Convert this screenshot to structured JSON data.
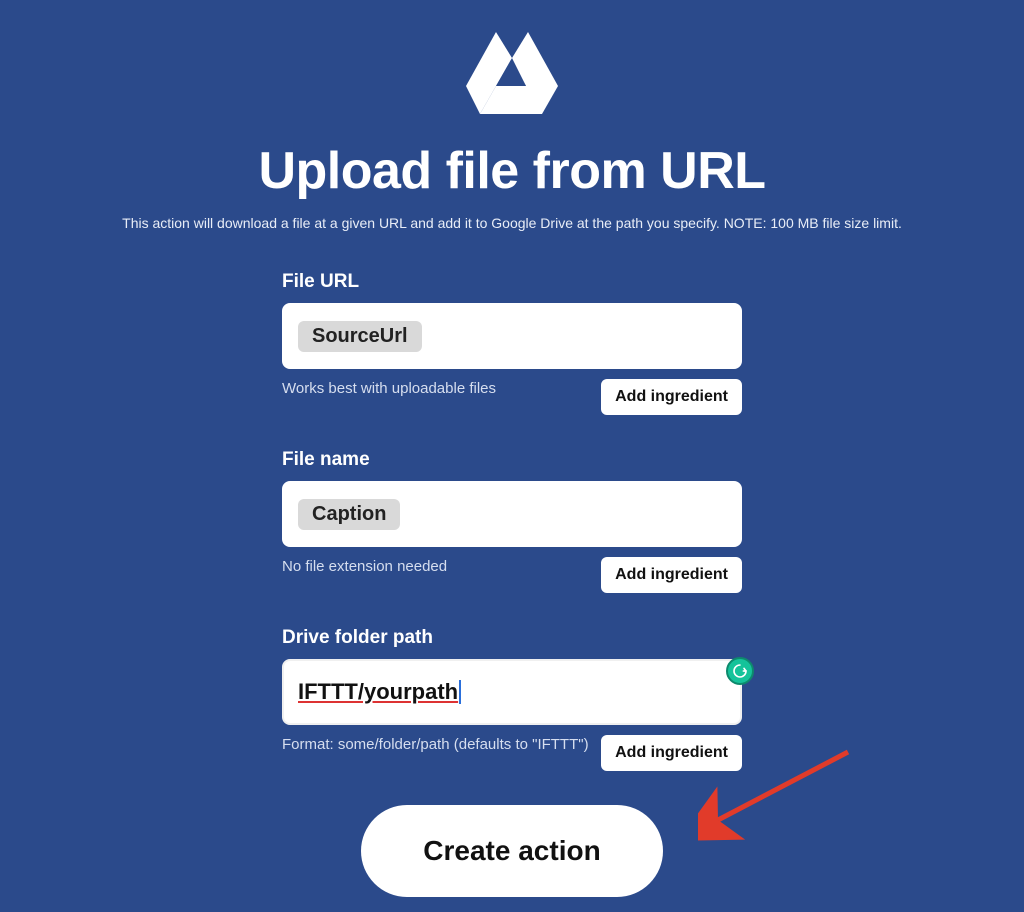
{
  "header": {
    "title": "Upload file from URL",
    "subtitle": "This action will download a file at a given URL and add it to Google Drive at the path you specify. NOTE: 100 MB file size limit."
  },
  "fields": {
    "file_url": {
      "label": "File URL",
      "chip": "SourceUrl",
      "hint": "Works best with uploadable files",
      "add_label": "Add ingredient"
    },
    "file_name": {
      "label": "File name",
      "chip": "Caption",
      "hint": "No file extension needed",
      "add_label": "Add ingredient"
    },
    "folder_path": {
      "label": "Drive folder path",
      "value": "IFTTT/yourpath",
      "hint": "Format: some/folder/path (defaults to \"IFTTT\")",
      "add_label": "Add ingredient"
    }
  },
  "submit": {
    "label": "Create action"
  },
  "badge": {
    "letter": "G"
  }
}
